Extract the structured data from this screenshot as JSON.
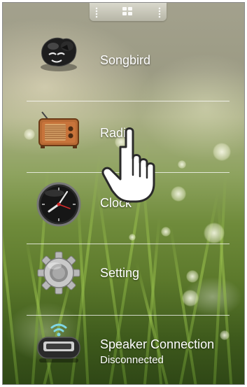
{
  "menu": {
    "items": [
      {
        "label": "Songbird",
        "icon": "songbird-icon"
      },
      {
        "label": "Radio",
        "icon": "radio-icon"
      },
      {
        "label": "Clock",
        "icon": "clock-icon"
      },
      {
        "label": "Setting",
        "icon": "gear-icon"
      },
      {
        "label": "Speaker Connection",
        "sublabel": "Disconnected",
        "icon": "speaker-connection-icon"
      }
    ]
  },
  "top_handle": {
    "icon": "grid-icon"
  },
  "cursor": {
    "icon": "hand-pointer-icon"
  },
  "colors": {
    "label_text": "#ffffff",
    "divider": "#ffffff",
    "radio_body": "#c8743b",
    "radio_grille": "#d9a46a"
  }
}
